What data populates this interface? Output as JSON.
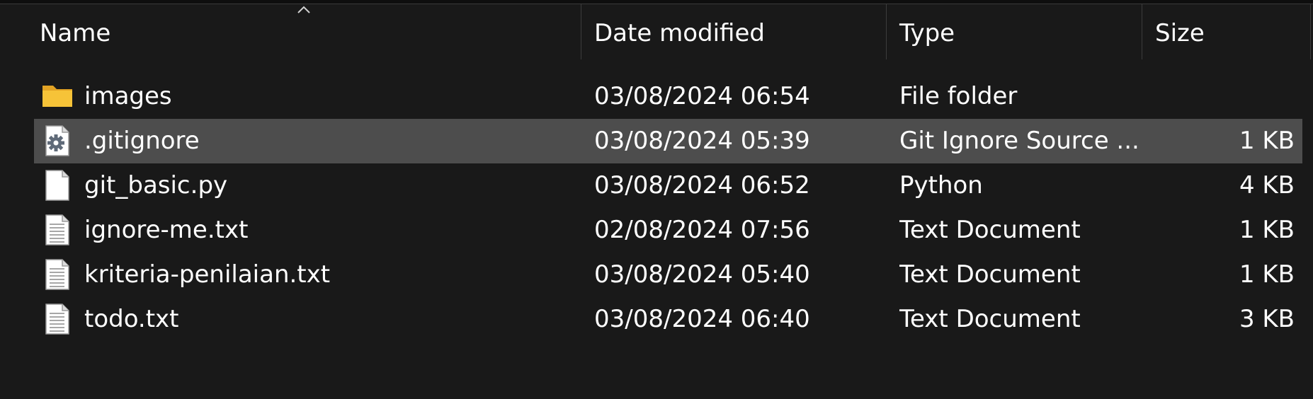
{
  "columns": {
    "name": "Name",
    "date": "Date modified",
    "type": "Type",
    "size": "Size"
  },
  "files": [
    {
      "icon": "folder-icon",
      "name": "images",
      "date": "03/08/2024 06:54",
      "type": "File folder",
      "size": "",
      "selected": false
    },
    {
      "icon": "gear-file-icon",
      "name": ".gitignore",
      "date": "03/08/2024 05:39",
      "type": "Git Ignore Source ...",
      "size": "1 KB",
      "selected": true
    },
    {
      "icon": "blank-file-icon",
      "name": "git_basic.py",
      "date": "03/08/2024 06:52",
      "type": "Python",
      "size": "4 KB",
      "selected": false
    },
    {
      "icon": "text-file-icon",
      "name": "ignore-me.txt",
      "date": "02/08/2024 07:56",
      "type": "Text Document",
      "size": "1 KB",
      "selected": false
    },
    {
      "icon": "text-file-icon",
      "name": "kriteria-penilaian.txt",
      "date": "03/08/2024 05:40",
      "type": "Text Document",
      "size": "1 KB",
      "selected": false
    },
    {
      "icon": "text-file-icon",
      "name": "todo.txt",
      "date": "03/08/2024 06:40",
      "type": "Text Document",
      "size": "3 KB",
      "selected": false
    }
  ],
  "colors": {
    "background": "#191919",
    "selected_row": "#4d4d4d",
    "folder": "#f6c338"
  }
}
